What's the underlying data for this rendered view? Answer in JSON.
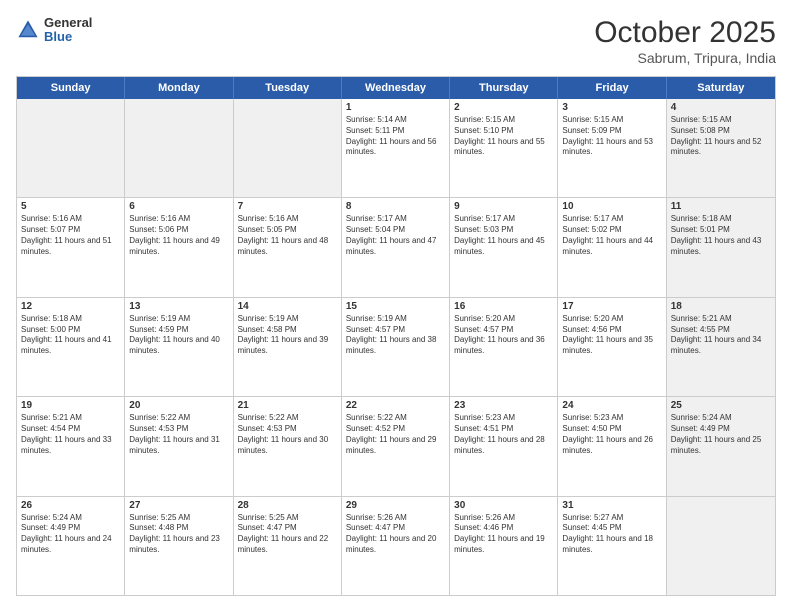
{
  "header": {
    "logo": {
      "general": "General",
      "blue": "Blue"
    },
    "month": "October 2025",
    "location": "Sabrum, Tripura, India"
  },
  "weekdays": [
    "Sunday",
    "Monday",
    "Tuesday",
    "Wednesday",
    "Thursday",
    "Friday",
    "Saturday"
  ],
  "rows": [
    [
      {
        "day": "",
        "text": "",
        "shaded": true
      },
      {
        "day": "",
        "text": "",
        "shaded": true
      },
      {
        "day": "",
        "text": "",
        "shaded": true
      },
      {
        "day": "1",
        "text": "Sunrise: 5:14 AM\nSunset: 5:11 PM\nDaylight: 11 hours and 56 minutes."
      },
      {
        "day": "2",
        "text": "Sunrise: 5:15 AM\nSunset: 5:10 PM\nDaylight: 11 hours and 55 minutes."
      },
      {
        "day": "3",
        "text": "Sunrise: 5:15 AM\nSunset: 5:09 PM\nDaylight: 11 hours and 53 minutes."
      },
      {
        "day": "4",
        "text": "Sunrise: 5:15 AM\nSunset: 5:08 PM\nDaylight: 11 hours and 52 minutes.",
        "shaded": true
      }
    ],
    [
      {
        "day": "5",
        "text": "Sunrise: 5:16 AM\nSunset: 5:07 PM\nDaylight: 11 hours and 51 minutes."
      },
      {
        "day": "6",
        "text": "Sunrise: 5:16 AM\nSunset: 5:06 PM\nDaylight: 11 hours and 49 minutes."
      },
      {
        "day": "7",
        "text": "Sunrise: 5:16 AM\nSunset: 5:05 PM\nDaylight: 11 hours and 48 minutes."
      },
      {
        "day": "8",
        "text": "Sunrise: 5:17 AM\nSunset: 5:04 PM\nDaylight: 11 hours and 47 minutes."
      },
      {
        "day": "9",
        "text": "Sunrise: 5:17 AM\nSunset: 5:03 PM\nDaylight: 11 hours and 45 minutes."
      },
      {
        "day": "10",
        "text": "Sunrise: 5:17 AM\nSunset: 5:02 PM\nDaylight: 11 hours and 44 minutes."
      },
      {
        "day": "11",
        "text": "Sunrise: 5:18 AM\nSunset: 5:01 PM\nDaylight: 11 hours and 43 minutes.",
        "shaded": true
      }
    ],
    [
      {
        "day": "12",
        "text": "Sunrise: 5:18 AM\nSunset: 5:00 PM\nDaylight: 11 hours and 41 minutes."
      },
      {
        "day": "13",
        "text": "Sunrise: 5:19 AM\nSunset: 4:59 PM\nDaylight: 11 hours and 40 minutes."
      },
      {
        "day": "14",
        "text": "Sunrise: 5:19 AM\nSunset: 4:58 PM\nDaylight: 11 hours and 39 minutes."
      },
      {
        "day": "15",
        "text": "Sunrise: 5:19 AM\nSunset: 4:57 PM\nDaylight: 11 hours and 38 minutes."
      },
      {
        "day": "16",
        "text": "Sunrise: 5:20 AM\nSunset: 4:57 PM\nDaylight: 11 hours and 36 minutes."
      },
      {
        "day": "17",
        "text": "Sunrise: 5:20 AM\nSunset: 4:56 PM\nDaylight: 11 hours and 35 minutes."
      },
      {
        "day": "18",
        "text": "Sunrise: 5:21 AM\nSunset: 4:55 PM\nDaylight: 11 hours and 34 minutes.",
        "shaded": true
      }
    ],
    [
      {
        "day": "19",
        "text": "Sunrise: 5:21 AM\nSunset: 4:54 PM\nDaylight: 11 hours and 33 minutes."
      },
      {
        "day": "20",
        "text": "Sunrise: 5:22 AM\nSunset: 4:53 PM\nDaylight: 11 hours and 31 minutes."
      },
      {
        "day": "21",
        "text": "Sunrise: 5:22 AM\nSunset: 4:53 PM\nDaylight: 11 hours and 30 minutes."
      },
      {
        "day": "22",
        "text": "Sunrise: 5:22 AM\nSunset: 4:52 PM\nDaylight: 11 hours and 29 minutes."
      },
      {
        "day": "23",
        "text": "Sunrise: 5:23 AM\nSunset: 4:51 PM\nDaylight: 11 hours and 28 minutes."
      },
      {
        "day": "24",
        "text": "Sunrise: 5:23 AM\nSunset: 4:50 PM\nDaylight: 11 hours and 26 minutes."
      },
      {
        "day": "25",
        "text": "Sunrise: 5:24 AM\nSunset: 4:49 PM\nDaylight: 11 hours and 25 minutes.",
        "shaded": true
      }
    ],
    [
      {
        "day": "26",
        "text": "Sunrise: 5:24 AM\nSunset: 4:49 PM\nDaylight: 11 hours and 24 minutes."
      },
      {
        "day": "27",
        "text": "Sunrise: 5:25 AM\nSunset: 4:48 PM\nDaylight: 11 hours and 23 minutes."
      },
      {
        "day": "28",
        "text": "Sunrise: 5:25 AM\nSunset: 4:47 PM\nDaylight: 11 hours and 22 minutes."
      },
      {
        "day": "29",
        "text": "Sunrise: 5:26 AM\nSunset: 4:47 PM\nDaylight: 11 hours and 20 minutes."
      },
      {
        "day": "30",
        "text": "Sunrise: 5:26 AM\nSunset: 4:46 PM\nDaylight: 11 hours and 19 minutes."
      },
      {
        "day": "31",
        "text": "Sunrise: 5:27 AM\nSunset: 4:45 PM\nDaylight: 11 hours and 18 minutes."
      },
      {
        "day": "",
        "text": "",
        "shaded": true
      }
    ]
  ]
}
